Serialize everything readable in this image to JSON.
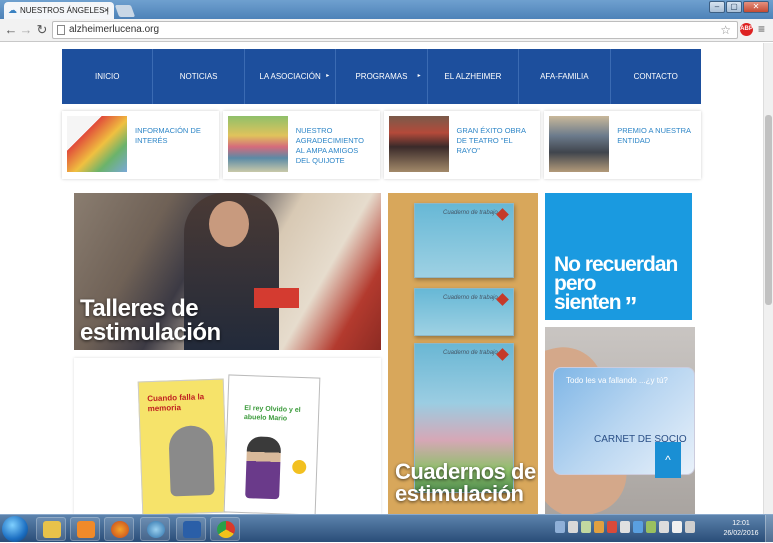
{
  "browser": {
    "tab_title": "NUESTROS ÁNGELES |",
    "tab_close": "×",
    "url": "alzheimerlucena.org",
    "ext_badge": "ABP",
    "window_buttons": [
      "–",
      "▢",
      "✕"
    ]
  },
  "nav": {
    "items": [
      {
        "label": "INICIO"
      },
      {
        "label": "NOTICIAS"
      },
      {
        "label": "LA ASOCIACIÓN",
        "caret": "▸"
      },
      {
        "label": "PROGRAMAS",
        "caret": "▸"
      },
      {
        "label": "EL ALZHEIMER"
      },
      {
        "label": "AFA-FAMILIA"
      },
      {
        "label": "CONTACTO"
      }
    ]
  },
  "news_cards": [
    {
      "title": "INFORMACIÓN DE INTERÉS"
    },
    {
      "title": "NUESTRO AGRADECIMIENTO AL AMPA AMIGOS DEL QUIJOTE"
    },
    {
      "title": "GRAN ÉXITO OBRA DE TEATRO \"EL RAYO\""
    },
    {
      "title": "PREMIO A NUESTRA ENTIDAD"
    }
  ],
  "tiles": {
    "talleres": {
      "line1": "Talleres de",
      "line2": "estimulación"
    },
    "cuadernos": {
      "line1": "Cuadernos de",
      "line2": "estimulación",
      "book_labels": [
        "Cuaderno de trabajo",
        "Cuaderno de trabajo",
        "Cuaderno de trabajo"
      ]
    },
    "no_recuerdan": {
      "line1": "No recuerdan",
      "line2": "pero",
      "line3": "sienten",
      "quote": "”"
    },
    "carnet": {
      "card_line1": "Todo les va fallando ...¿y tú?",
      "card_line2": "CARNET DE SOCIO",
      "back_to_top": "^"
    },
    "cuando": {
      "cover1_title": "Cuando falla la memoria",
      "cover2_title": "El rey Olvido y el abuelo Mario"
    }
  },
  "taskbar": {
    "time": "12:01",
    "date": "26/02/2016"
  },
  "colors": {
    "nav_blue": "#1d4f9d",
    "link_blue": "#2e86c7",
    "tile_blue": "#1a9ae0"
  }
}
